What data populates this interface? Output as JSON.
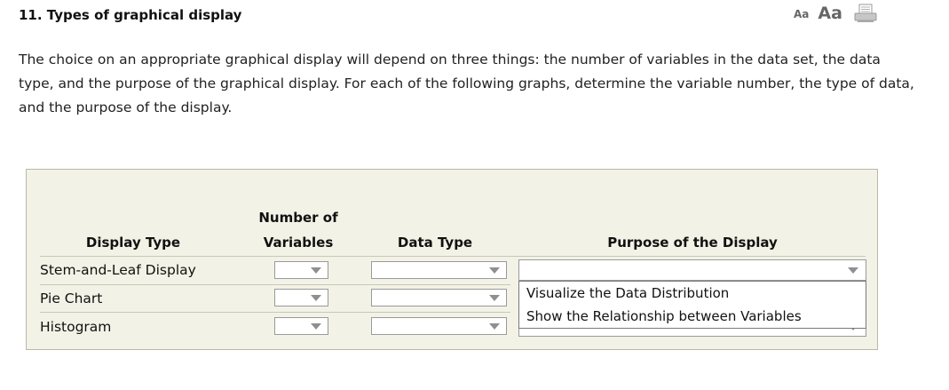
{
  "header": {
    "title": "11. Types of graphical display",
    "font_small_label": "Aa",
    "font_large_label": "Aa",
    "print_icon": "print-icon"
  },
  "intro": {
    "text": "The choice on an appropriate graphical display will depend on three things: the number of variables in the data set, the data type, and the purpose of the graphical display. For each of the following graphs, determine the variable number, the type of data, and the purpose of the display."
  },
  "table": {
    "headers": {
      "display_type": "Display Type",
      "num_vars_line1": "Number of",
      "num_vars_line2": "Variables",
      "data_type": "Data Type",
      "purpose": "Purpose of the Display"
    },
    "rows": [
      {
        "label": "Stem-and-Leaf Display",
        "num_vars": "",
        "data_type": "",
        "purpose": ""
      },
      {
        "label": "Pie Chart",
        "num_vars": "",
        "data_type": "",
        "purpose": ""
      },
      {
        "label": "Histogram",
        "num_vars": "",
        "data_type": "",
        "purpose": ""
      }
    ],
    "purpose_options": [
      "Visualize the Data Distribution",
      "Show the Relationship between Variables"
    ]
  },
  "colors": {
    "panel_bg": "#f2f2e6",
    "panel_border": "#b9b9a6"
  }
}
